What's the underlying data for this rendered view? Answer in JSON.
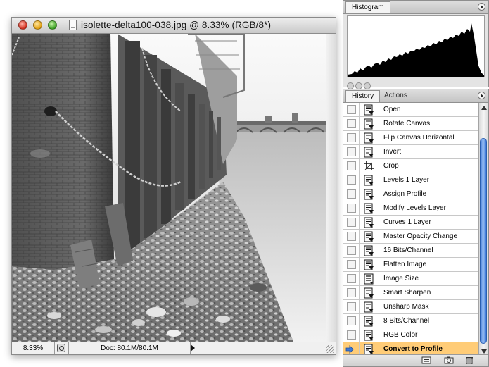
{
  "document_window": {
    "title": "isolette-delta100-038.jpg @ 8.33% (RGB/8*)",
    "status": {
      "zoom": "8.33%",
      "doc_size": "Doc: 80.1M/80.1M"
    }
  },
  "histogram_palette": {
    "tab_label": "Histogram"
  },
  "history_palette": {
    "tabs": [
      {
        "label": "History",
        "active": true
      },
      {
        "label": "Actions",
        "active": false
      }
    ],
    "steps": [
      {
        "label": "Open",
        "icon": "history-state-icon"
      },
      {
        "label": "Rotate Canvas",
        "icon": "history-state-icon"
      },
      {
        "label": "Flip Canvas Horizontal",
        "icon": "history-state-icon"
      },
      {
        "label": "Invert",
        "icon": "history-state-icon"
      },
      {
        "label": "Crop",
        "icon": "crop-icon"
      },
      {
        "label": "Levels 1 Layer",
        "icon": "history-state-icon"
      },
      {
        "label": "Assign Profile",
        "icon": "history-state-icon"
      },
      {
        "label": "Modify Levels Layer",
        "icon": "history-state-icon"
      },
      {
        "label": "Curves 1 Layer",
        "icon": "history-state-icon"
      },
      {
        "label": "Master Opacity Change",
        "icon": "history-state-icon"
      },
      {
        "label": "16 Bits/Channel",
        "icon": "history-state-icon"
      },
      {
        "label": "Flatten Image",
        "icon": "history-state-icon"
      },
      {
        "label": "Image Size",
        "icon": "image-size-icon"
      },
      {
        "label": "Smart Sharpen",
        "icon": "history-state-icon"
      },
      {
        "label": "Unsharp Mask",
        "icon": "history-state-icon"
      },
      {
        "label": "8 Bits/Channel",
        "icon": "history-state-icon"
      },
      {
        "label": "RGB Color",
        "icon": "history-state-icon"
      },
      {
        "label": "Convert to Profile",
        "icon": "history-state-icon",
        "selected": true
      }
    ],
    "selection_color": "#ffcc77",
    "footer_buttons": [
      "new-document-from-state-icon",
      "new-snapshot-icon",
      "trash-icon"
    ]
  }
}
